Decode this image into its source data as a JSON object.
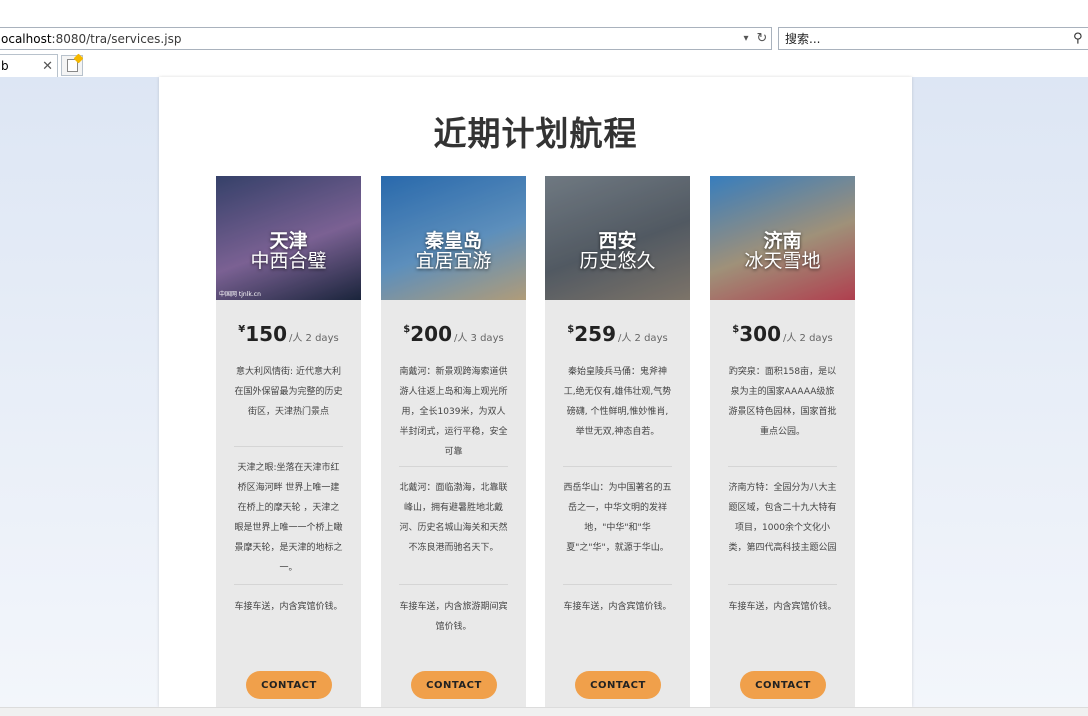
{
  "browser": {
    "address_host": "ocalhost",
    "address_rest": ":8080/tra/services.jsp",
    "search_placeholder": "搜索...",
    "tab_label": "b"
  },
  "page": {
    "title": "近期计划航程",
    "contact_label": "CONTACT"
  },
  "cards": [
    {
      "city": "天津",
      "tag": "中西合璧",
      "credit": "中国网 tjnlk.cn",
      "currency": "¥",
      "price": "150",
      "per": "/人 2 days",
      "desc1": "意大利风情街: 近代意大利在国外保留最为完整的历史街区，天津热门景点",
      "desc2": "天津之眼:坐落在天津市红桥区海河畔 世界上唯一建在桥上的摩天轮 ，天津之眼是世界上唯一一个桥上瞰景摩天轮，是天津的地标之一。",
      "desc3": "车接车送，内含宾馆价钱。",
      "colors": [
        "#3d4a78",
        "#8c6fa8",
        "#1e2a44"
      ]
    },
    {
      "city": "秦皇岛",
      "tag": "宜居宜游",
      "credit": "",
      "currency": "$",
      "price": "200",
      "per": "/人 3 days",
      "desc1": "南戴河：新景观跨海索道供游人往返上岛和海上观光所用，全长1039米，为双人半封闭式，运行平稳，安全可靠",
      "desc2": "北戴河：面临渤海，北靠联峰山，拥有避暑胜地北戴河、历史名城山海关和天然不冻良港而驰名天下。",
      "desc3": "车接车送，内含旅游期间宾馆价钱。",
      "colors": [
        "#2f78c4",
        "#6aa3d6",
        "#c9b28a"
      ]
    },
    {
      "city": "西安",
      "tag": "历史悠久",
      "credit": "",
      "currency": "$",
      "price": "259",
      "per": "/人 2 days",
      "desc1": "秦始皇陵兵马俑：鬼斧神工,绝无仅有,雄伟壮观,气势磅礴, 个性鲜明,惟妙惟肖,举世无双,神态自若。",
      "desc2": "西岳华山：为中国著名的五岳之一，中华文明的发祥地，\"中华\"和\"华夏\"之\"华\"，就源于华山。",
      "desc3": "车接车送，内含宾馆价钱。",
      "colors": [
        "#7f8a94",
        "#5d6670",
        "#8e8478"
      ]
    },
    {
      "city": "济南",
      "tag": "冰天雪地",
      "credit": "",
      "currency": "$",
      "price": "300",
      "per": "/人 2 days",
      "desc1": "趵突泉：面积158亩，是以泉为主的国家AAAAA级旅游景区特色园林，国家首批重点公园。",
      "desc2": "济南方特：全园分为八大主题区域，包含二十九大特有项目，1000余个文化小类，第四代高科技主题公园",
      "desc3": "车接车送，内含宾馆价钱。",
      "colors": [
        "#3f8fd8",
        "#b6a58a",
        "#c8485a"
      ]
    }
  ]
}
